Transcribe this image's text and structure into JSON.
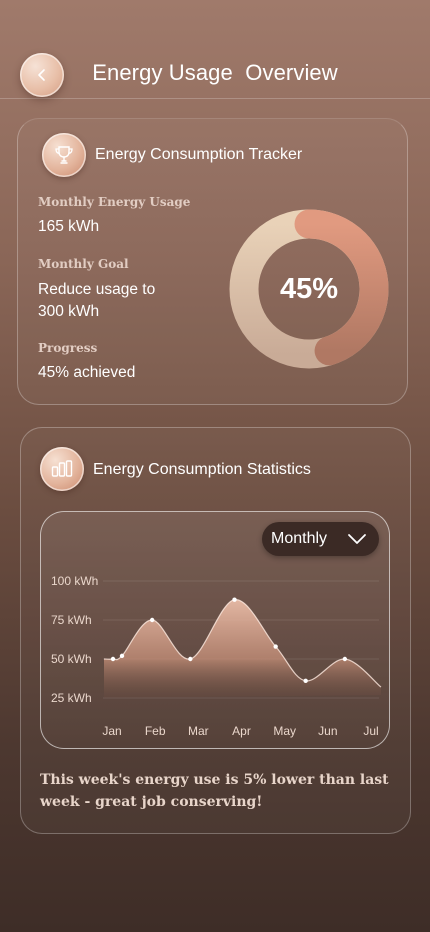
{
  "header": {
    "title": "Energy Usage  Overview",
    "back_icon": "chevron-left-icon"
  },
  "tracker": {
    "title": "Energy Consumption Tracker",
    "icon": "trophy-icon",
    "monthly_usage_label": "Monthly Energy Usage",
    "monthly_usage_value": "165 kWh",
    "goal_label": "Monthly Goal",
    "goal_line1": "Reduce usage to",
    "goal_line2": "300 kWh",
    "progress_label": "Progress",
    "progress_value": "45% achieved",
    "donut_text": "45%",
    "progress_fraction": 0.45,
    "colors": {
      "ring_filled": "#d98a72",
      "ring_track": "#e6cdb3"
    }
  },
  "stats": {
    "title": "Energy Consumption Statistics",
    "icon": "bar-chart-icon",
    "period": "Monthly",
    "message": "This week's energy use is 5% lower than last week - great job conserving!"
  },
  "chart_data": {
    "type": "area",
    "x": [
      "Jan",
      "Feb",
      "Mar",
      "Apr",
      "May",
      "Jun",
      "Jul"
    ],
    "y_ticks": [
      "100 kWh",
      "75 kWh",
      "50 kWh",
      "25 kWh"
    ],
    "ylim": [
      0,
      100
    ],
    "points": [
      {
        "x": "Jan",
        "y": 50
      },
      {
        "x": "Jan-Feb",
        "y": 52
      },
      {
        "x": "Feb",
        "y": 75
      },
      {
        "x": "Mar",
        "y": 50
      },
      {
        "x": "Apr",
        "y": 88
      },
      {
        "x": "May",
        "y": 58
      },
      {
        "x": "May-Jun",
        "y": 36
      },
      {
        "x": "Jun",
        "y": 50
      },
      {
        "x": "Jul",
        "y": 32
      }
    ],
    "grid": true
  }
}
